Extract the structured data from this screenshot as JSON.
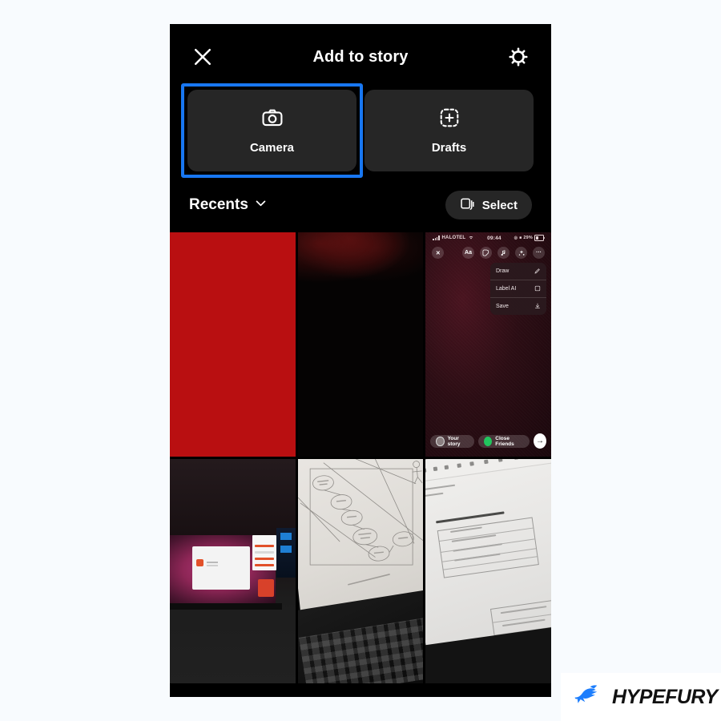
{
  "page": {
    "background_color": "#f8fbfe"
  },
  "header": {
    "title": "Add to story",
    "close_icon": "close-x-icon",
    "settings_icon": "gear-icon"
  },
  "cards": [
    {
      "label": "Camera",
      "icon": "camera-icon",
      "selected": true,
      "selection_color": "#1877f2"
    },
    {
      "label": "Drafts",
      "icon": "dashed-square-plus-icon",
      "selected": false
    }
  ],
  "gallery_bar": {
    "album_label": "Recents",
    "album_chevron_icon": "chevron-down-icon",
    "select_label": "Select",
    "select_icon": "multi-select-icon"
  },
  "thumbnails": [
    {
      "name": "thumbnail-solid-red",
      "description": "solid red image",
      "color": "#b90f11"
    },
    {
      "name": "thumbnail-dark",
      "description": "very dark image",
      "color": "#050303"
    },
    {
      "name": "thumbnail-story-editor",
      "description": "screenshot of instagram story editor"
    },
    {
      "name": "thumbnail-monitor-photo",
      "description": "photo of desktop monitor with ubuntu desktop"
    },
    {
      "name": "thumbnail-paper-diagram",
      "description": "photo of printed use case diagram on laptop"
    },
    {
      "name": "thumbnail-document-photo",
      "description": "photo of document with functional requirements table"
    }
  ],
  "story_thumb": {
    "status_bar": {
      "carrier": "HALOTEL",
      "time": "09:44",
      "battery": "29%"
    },
    "tools": {
      "close": "✕",
      "text": "Aa",
      "sticker": "sticker-icon",
      "music": "music-icon",
      "effects": "effects-icon",
      "more": "···"
    },
    "menu": [
      {
        "label": "Draw",
        "icon": "pen-icon"
      },
      {
        "label": "Label AI",
        "icon": "label-icon"
      },
      {
        "label": "Save",
        "icon": "download-icon"
      }
    ],
    "bottom": {
      "your_story": "Your story",
      "close_friends": "Close Friends",
      "send_icon": "arrow-right-icon"
    }
  },
  "watermark": {
    "brand": "HYPEFURY",
    "logo_icon": "hypefury-bird-icon",
    "logo_color": "#1d7efd"
  }
}
